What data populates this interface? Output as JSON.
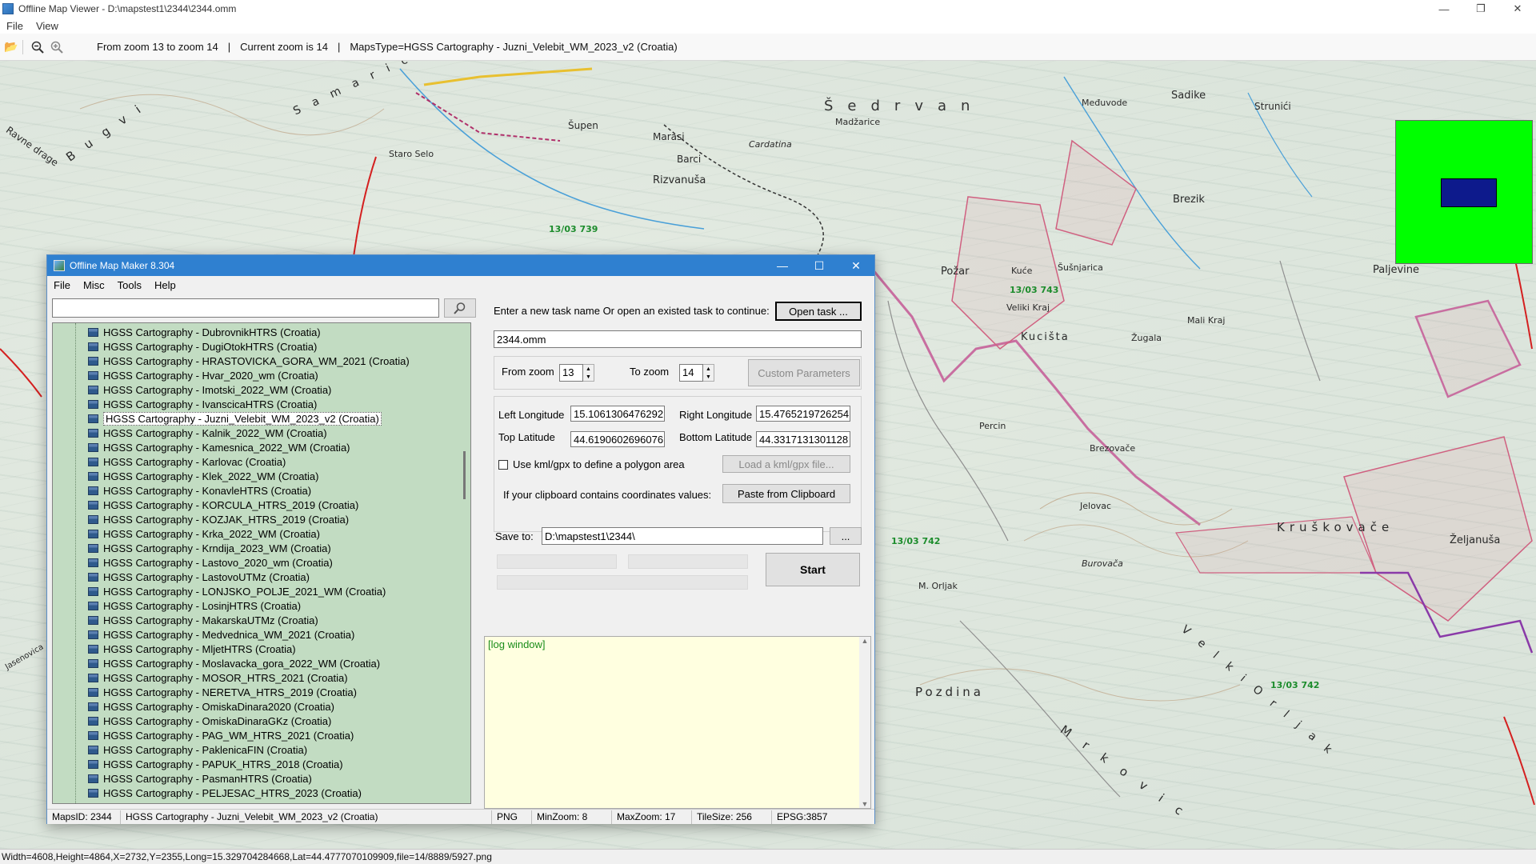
{
  "viewer": {
    "title": "Offline Map Viewer - D:\\mapstest1\\2344\\2344.omm",
    "menu": [
      "File",
      "View"
    ],
    "toolbar": {
      "zoom_range": "From zoom 13 to zoom 14",
      "current_zoom": "Current zoom is 14",
      "maps_type": "MapsType=HGSS Cartography - Juzni_Velebit_WM_2023_v2 (Croatia)"
    },
    "status": "Width=4608,Height=4864,X=2732,Y=2355,Long=15.329704284668,Lat=44.4777070109909,file=14/8889/5927.png"
  },
  "map_labels": {
    "sedrvan": "Šedrvan",
    "sadike": "Sadike",
    "strunici": "Strunići",
    "medjuvode": "Međuvode",
    "madzarice": "Madžarice",
    "supen": "Šupen",
    "marasi": "Marasi",
    "barci": "Barci",
    "rizvanusa": "Rizvanuša",
    "cardatina": "Cardatina",
    "staro_selo": "Staro Selo",
    "brezik": "Brezik",
    "pozar": "Požar",
    "kuce": "Kuće",
    "susnjarica": "Šušnjarica",
    "veliki_kraj": "Veliki Kraj",
    "mali_kraj": "Mali Kraj",
    "kucista": "Kucišta",
    "zugala": "Žugala",
    "paljevine": "Paljevine",
    "percin": "Percin",
    "brezovace": "Brezovače",
    "kruskovace": "Kruškovače",
    "zeljanusa": "Željanuša",
    "jelovac": "Jelovac",
    "burovaca": "Burovača",
    "pozdina": "Pozdina",
    "orljak": "M. Orljak",
    "pinc_13_03_739": "13/03 739",
    "pinc_13_03_743": "13/03 743",
    "pinc_13_03_742a": "13/03 742",
    "pinc_13_03_742b": "13/03 742",
    "mrkovic": "M r k o v i c",
    "velki_orljak": "V e l k i  O r l j a k",
    "ravne_drage": "Ravne drage",
    "bugvi": "B u g v i",
    "samarica": "S a m a r i c",
    "jasenovica": "Jasenovica"
  },
  "dialog": {
    "title": "Offline Map Maker 8.304",
    "menu": [
      "File",
      "Misc",
      "Tools",
      "Help"
    ],
    "search_placeholder": "",
    "map_list": [
      "HGSS Cartography - DubrovnikHTRS (Croatia)",
      "HGSS Cartography - DugiOtokHTRS (Croatia)",
      "HGSS Cartography - HRASTOVICKA_GORA_WM_2021 (Croatia)",
      "HGSS Cartography - Hvar_2020_wm (Croatia)",
      "HGSS Cartography - Imotski_2022_WM (Croatia)",
      "HGSS Cartography - IvanscicaHTRS (Croatia)",
      "HGSS Cartography - Juzni_Velebit_WM_2023_v2 (Croatia)",
      "HGSS Cartography - Kalnik_2022_WM (Croatia)",
      "HGSS Cartography - Kamesnica_2022_WM (Croatia)",
      "HGSS Cartography - Karlovac (Croatia)",
      "HGSS Cartography - Klek_2022_WM (Croatia)",
      "HGSS Cartography - KonavleHTRS (Croatia)",
      "HGSS Cartography - KORCULA_HTRS_2019 (Croatia)",
      "HGSS Cartography - KOZJAK_HTRS_2019 (Croatia)",
      "HGSS Cartography - Krka_2022_WM (Croatia)",
      "HGSS Cartography - Krndija_2023_WM (Croatia)",
      "HGSS Cartography - Lastovo_2020_wm (Croatia)",
      "HGSS Cartography - LastovoUTMz (Croatia)",
      "HGSS Cartography - LONJSKO_POLJE_2021_WM (Croatia)",
      "HGSS Cartography - LosinjHTRS (Croatia)",
      "HGSS Cartography - MakarskaUTMz (Croatia)",
      "HGSS Cartography - Medvednica_WM_2021 (Croatia)",
      "HGSS Cartography - MljetHTRS (Croatia)",
      "HGSS Cartography - Moslavacka_gora_2022_WM (Croatia)",
      "HGSS Cartography - MOSOR_HTRS_2021 (Croatia)",
      "HGSS Cartography - NERETVA_HTRS_2019 (Croatia)",
      "HGSS Cartography - OmiskaDinara2020 (Croatia)",
      "HGSS Cartography - OmiskaDinaraGKz (Croatia)",
      "HGSS Cartography - PAG_WM_HTRS_2021 (Croatia)",
      "HGSS Cartography - PaklenicaFIN (Croatia)",
      "HGSS Cartography - PAPUK_HTRS_2018 (Croatia)",
      "HGSS Cartography - PasmanHTRS (Croatia)",
      "HGSS Cartography - PELJESAC_HTRS_2023 (Croatia)"
    ],
    "selected_index": 6,
    "task_label": "Enter a new task name Or open an existed task to continue:",
    "open_task_label": "Open task ...",
    "task_name": "2344.omm",
    "from_zoom_label": "From zoom",
    "from_zoom": "13",
    "to_zoom_label": "To zoom",
    "to_zoom": "14",
    "custom_params_label": "Custom Parameters",
    "left_lon_label": "Left Longitude",
    "left_lon": "15.1061306476292",
    "right_lon_label": "Right Longitude",
    "right_lon": "15.4765219726254",
    "top_lat_label": "Top Latitude",
    "top_lat": "44.6190602696076",
    "bottom_lat_label": "Bottom Latitude",
    "bottom_lat": "44.3317131301128",
    "kml_label": "Use kml/gpx to define a polygon area",
    "load_kml_label": "Load a kml/gpx file...",
    "clipboard_label": "If your clipboard contains coordinates values:",
    "paste_label": "Paste from Clipboard",
    "save_to_label": "Save to:",
    "save_to": "D:\\mapstest1\\2344\\",
    "browse_label": "...",
    "start_label": "Start",
    "log_text": "[log window]",
    "status": {
      "maps_id": "MapsID: 2344",
      "map_name": "HGSS Cartography - Juzni_Velebit_WM_2023_v2 (Croatia)",
      "format": "PNG",
      "min_zoom": "MinZoom: 8",
      "max_zoom": "MaxZoom: 17",
      "tile_size": "TileSize: 256",
      "epsg": "EPSG:3857"
    }
  },
  "colors": {
    "minimap_bg": "#00ff00",
    "minimap_view": "#0d1a8c",
    "list_bg": "#c2dcc2",
    "dialog_title": "#2f80d0",
    "log_bg": "#ffffe0"
  }
}
